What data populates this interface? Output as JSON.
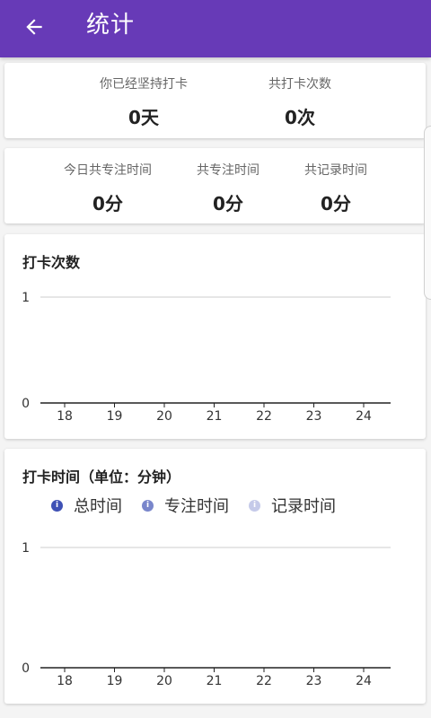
{
  "header": {
    "title": "统计",
    "back_icon": "arrow-back-icon"
  },
  "summary1": [
    {
      "label": "你已经坚持打卡",
      "value": "0天"
    },
    {
      "label": "共打卡次数",
      "value": "0次"
    }
  ],
  "summary2": [
    {
      "label": "今日共专注时间",
      "value": "0分"
    },
    {
      "label": "共专注时间",
      "value": "0分"
    },
    {
      "label": "共记录时间",
      "value": "0分"
    }
  ],
  "colors": {
    "accent": "#673ab7",
    "legend_total": "#3f51b5",
    "legend_focus": "#7986cb",
    "legend_record": "#c5cae9"
  },
  "chart_data": [
    {
      "type": "line",
      "title": "打卡次数",
      "categories": [
        "18",
        "19",
        "20",
        "21",
        "22",
        "23",
        "24"
      ],
      "series": [
        {
          "values": [
            0,
            0,
            0,
            0,
            0,
            0,
            0
          ]
        }
      ],
      "y_ticks": [
        "0",
        "1"
      ],
      "ylim": [
        0,
        1
      ],
      "grid": true
    },
    {
      "type": "line",
      "title": "打卡时间（单位：分钟）",
      "categories": [
        "18",
        "19",
        "20",
        "21",
        "22",
        "23",
        "24"
      ],
      "series": [
        {
          "name": "总时间",
          "values": [
            0,
            0,
            0,
            0,
            0,
            0,
            0
          ]
        },
        {
          "name": "专注时间",
          "values": [
            0,
            0,
            0,
            0,
            0,
            0,
            0
          ]
        },
        {
          "name": "记录时间",
          "values": [
            0,
            0,
            0,
            0,
            0,
            0,
            0
          ]
        }
      ],
      "y_ticks": [
        "0",
        "1"
      ],
      "ylim": [
        0,
        1
      ],
      "grid": true,
      "legend": "top-left"
    }
  ]
}
